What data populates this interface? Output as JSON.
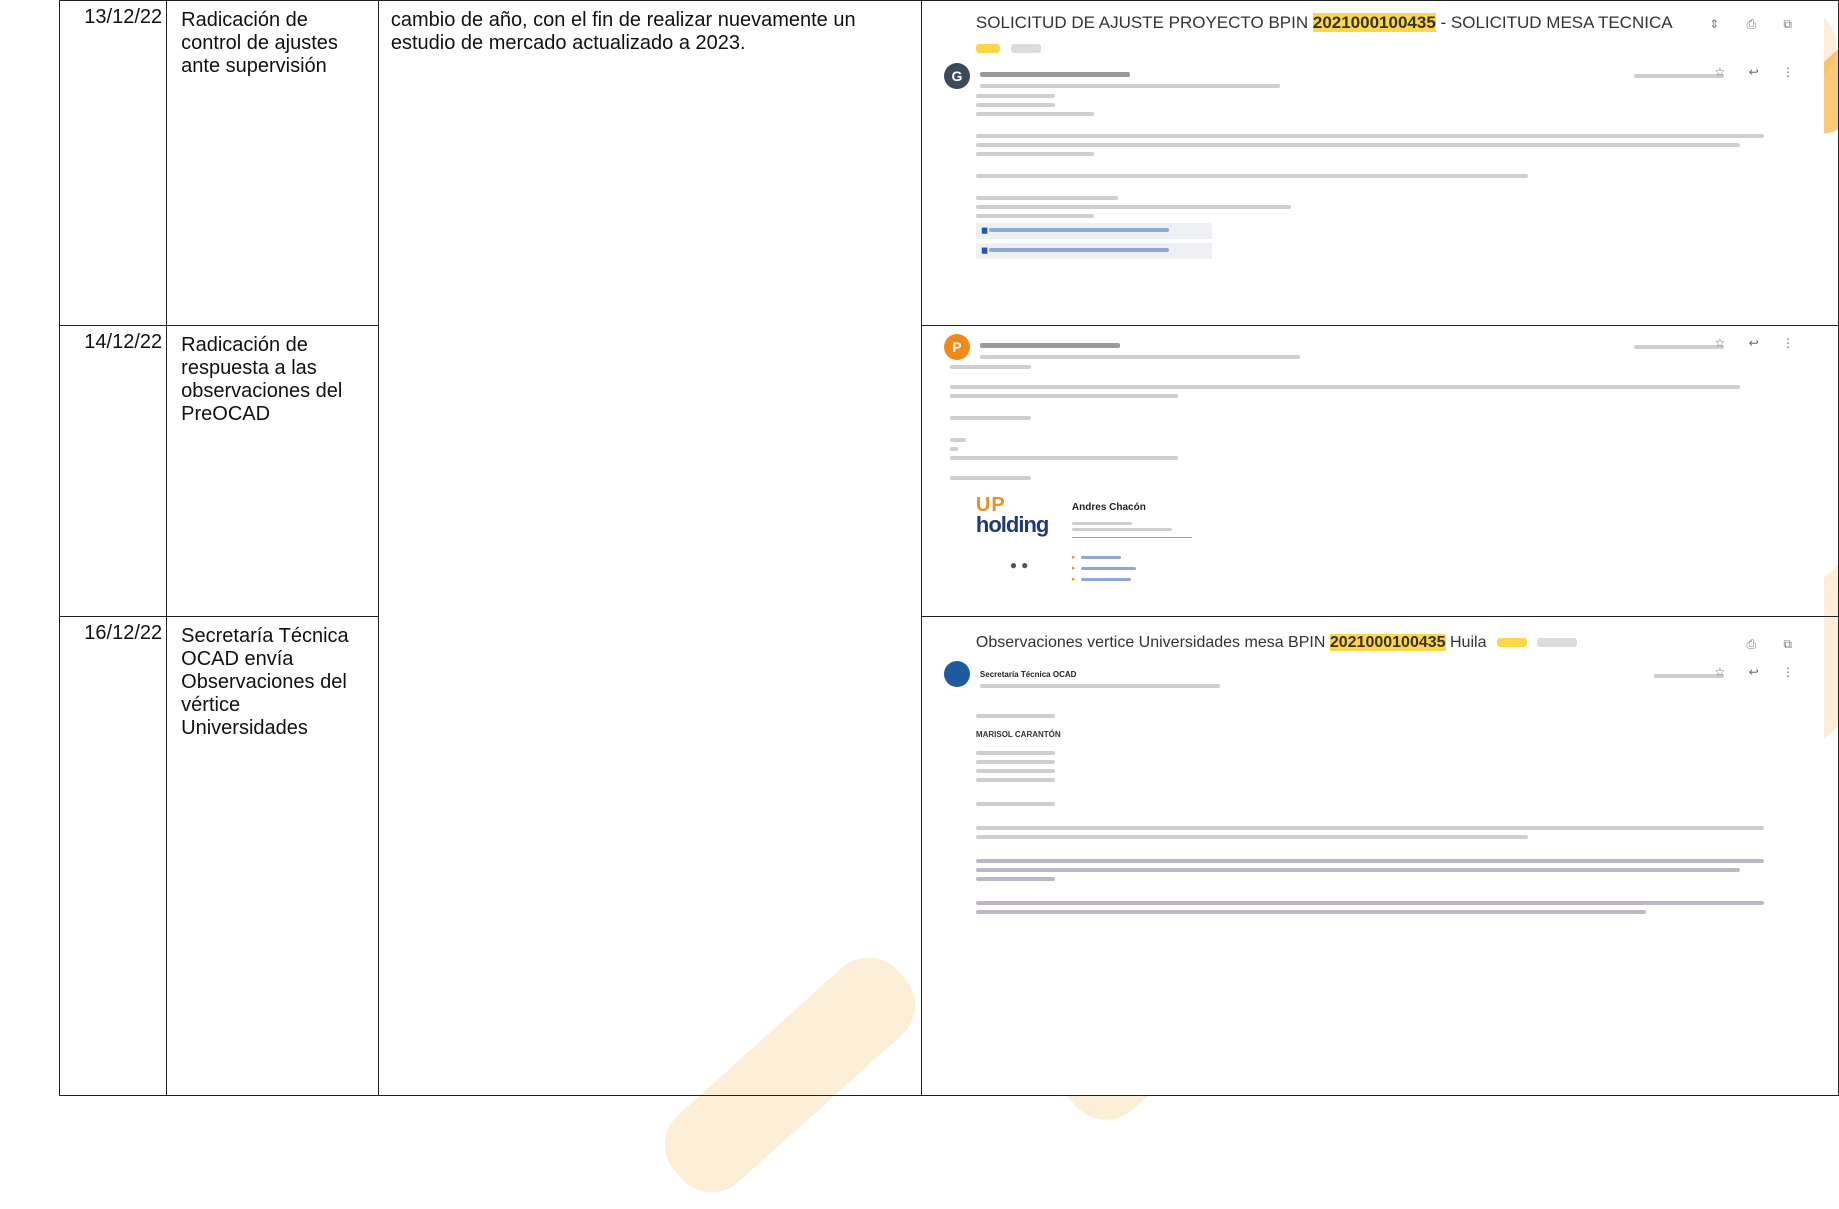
{
  "rows": [
    {
      "date": "13/12/22",
      "activity": "Radicación de control de ajustes ante supervisión",
      "description": "cambio de año, con el fin de realizar nuevamente un estudio de mercado actualizado a 2023.",
      "email": {
        "subject_prefix": "SOLICITUD DE AJUSTE PROYECTO BPIN",
        "bpin": "2021000100435",
        "subject_suffix": "- SOLICITUD MESA TECNICA",
        "avatar_letter": "G",
        "avatar_color": "#3c4a5a"
      }
    },
    {
      "date": "14/12/22",
      "activity": "Radicación de respuesta a las observaciones del PreOCAD",
      "email": {
        "avatar_letter": "P",
        "avatar_color": "#f08a1c",
        "signature": {
          "logo_top": "UP",
          "logo_bottom": "holding",
          "name": "Andres Chacón"
        }
      }
    },
    {
      "date": "16/12/22",
      "activity": "Secretaría Técnica OCAD envía Observaciones del vértice Universidades",
      "email": {
        "subject_prefix": "Observaciones vertice Universidades mesa BPIN",
        "bpin": "2021000100435",
        "subject_suffix": "Huila",
        "sender": "Secretaría Técnica OCAD",
        "avatar_color": "#1f5aa0",
        "recipient_name": "MARISOL CARANTÓN"
      }
    }
  ],
  "colors": {
    "highlight": "#ffd54a",
    "watermark": "#f5a623"
  }
}
